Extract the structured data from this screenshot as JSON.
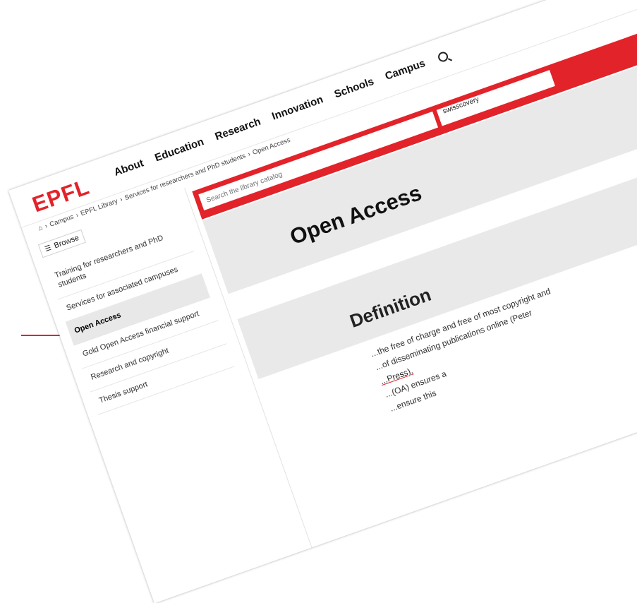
{
  "header": {
    "logo": "EPFL",
    "nav": [
      "About",
      "Education",
      "Research",
      "Innovation",
      "Schools",
      "Campus"
    ],
    "search_icon": "search-icon"
  },
  "breadcrumb": {
    "home_icon": "home-icon",
    "items": [
      "Campus",
      "EPFL Library",
      "Services for researchers and PhD students",
      "Open Access"
    ]
  },
  "sidebar": {
    "browse_label": "Browse",
    "items": [
      {
        "label": "Training for researchers and PhD students",
        "active": false
      },
      {
        "label": "Services for associated campuses",
        "active": false
      },
      {
        "label": "Open Access",
        "active": true
      },
      {
        "label": "Gold Open Access financial support",
        "active": false
      },
      {
        "label": "Research and copyright",
        "active": false
      },
      {
        "label": "Thesis support",
        "active": false
      }
    ]
  },
  "search": {
    "placeholder": "Search the library catalog",
    "scope": "swisscovery"
  },
  "main": {
    "title": "Open Access",
    "section_heading": "Definition",
    "body_line1": "...the free of charge and free of most copyright and",
    "body_line2": "...of disseminating publications online (Peter",
    "body_line3": "...Press).",
    "body_line4": "...(OA) ensures a",
    "body_line5": "...ensure this"
  },
  "colors": {
    "accent": "#e2232a",
    "band": "#e9e9e9"
  }
}
